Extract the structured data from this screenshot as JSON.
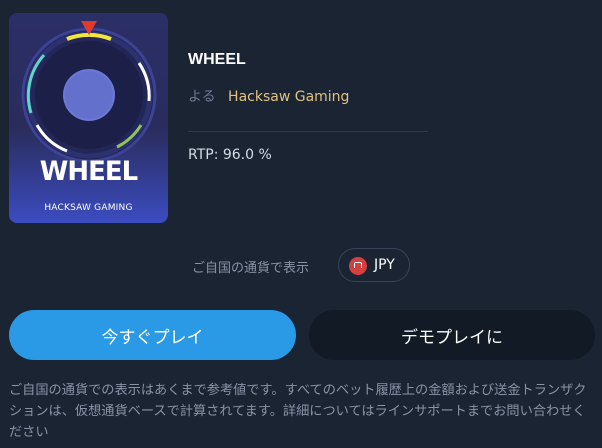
{
  "game_card": {
    "title": "WHEEL",
    "brand": "HACKSAW GAMING"
  },
  "game": {
    "title": "WHEEL",
    "by_label": "よる",
    "provider": "Hacksaw Gaming",
    "rtp": "RTP: 96.0 %"
  },
  "currency": {
    "label": "ご自国の通貨で表示",
    "code": "JPY",
    "flag_icon": "jp-flag-icon"
  },
  "buttons": {
    "play": "今すぐプレイ",
    "demo": "デモプレイに"
  },
  "disclaimer": "ご自国の通貨での表示はあくまで参考値です。すべてのベット履歴上の金額および送金トランザクションは、仮想通貨ベースで計算されてます。詳細についてはラインサポートまでお問い合わせください",
  "colors": {
    "background": "#1a2433",
    "play_button": "#2a9ae6",
    "demo_button": "#111a25",
    "provider_link": "#e0c283"
  }
}
